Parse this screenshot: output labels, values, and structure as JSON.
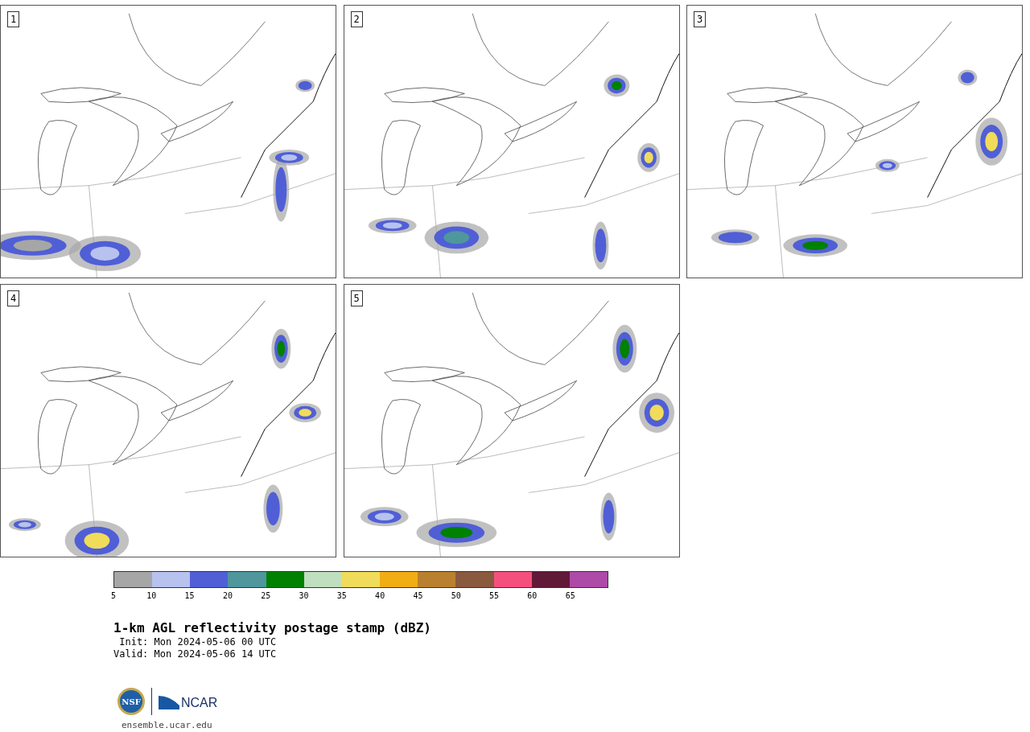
{
  "panels": [
    {
      "label": "1"
    },
    {
      "label": "2"
    },
    {
      "label": "3"
    },
    {
      "label": "4"
    },
    {
      "label": "5"
    }
  ],
  "colorbar": {
    "segments": [
      {
        "color": "#a6a6a6"
      },
      {
        "color": "#b7c2ee"
      },
      {
        "color": "#505fd6"
      },
      {
        "color": "#4f969d"
      },
      {
        "color": "#008100"
      },
      {
        "color": "#bfdfbf"
      },
      {
        "color": "#f0dc5a"
      },
      {
        "color": "#f0ae14"
      },
      {
        "color": "#b9812f"
      },
      {
        "color": "#8a5a3e"
      },
      {
        "color": "#f5507d"
      },
      {
        "color": "#611938"
      },
      {
        "color": "#ae4aa7"
      }
    ],
    "ticks": [
      "5",
      "10",
      "15",
      "20",
      "25",
      "30",
      "35",
      "40",
      "45",
      "50",
      "55",
      "60",
      "65"
    ]
  },
  "title": "1-km AGL reflectivity postage stamp (dBZ)",
  "init": " Init: Mon 2024-05-06 00 UTC",
  "valid": "Valid: Mon 2024-05-06 14 UTC",
  "logos": [
    {
      "kind": "nsf",
      "text": "NSF"
    },
    {
      "kind": "ncar",
      "text": "NCAR"
    }
  ],
  "footer": "ensemble.ucar.edu"
}
